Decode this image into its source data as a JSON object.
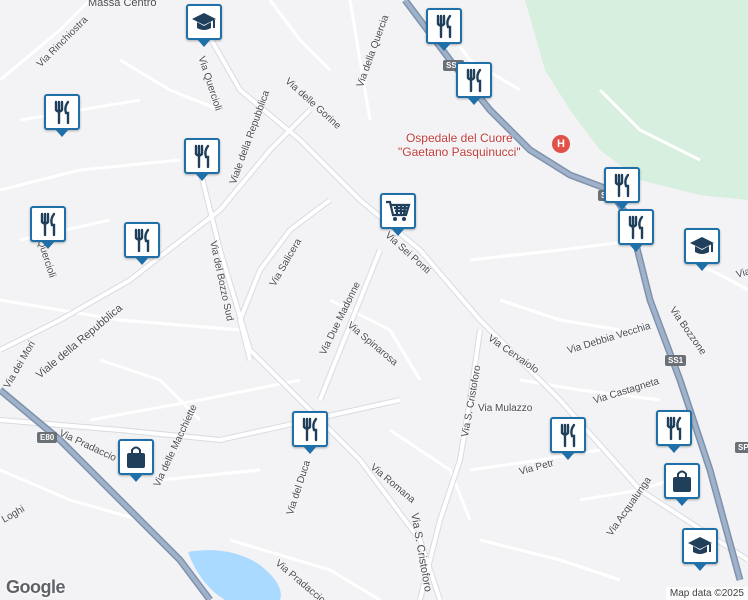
{
  "map": {
    "attribution_logo": "Google",
    "map_data": "Map data ©2025",
    "streets": [
      "Via Rinchiostra",
      "Massa Centro",
      "Via Quercioli",
      "Via delle Gorine",
      "Via della Quercia",
      "Viale della Repubblica",
      "Via Salicera",
      "Via del Bozzo Sud",
      "Via Sei Ponti",
      "Via Due Madonne",
      "Via Spinarosa",
      "Via Romana",
      "Viale della Repubblica",
      "Via dei Mori",
      "Via delle Macchiette",
      "Via Pradaccio",
      "Via del Duca",
      "Via S. Cristoforo",
      "Via Cervaiolo",
      "Via Debbia Vecchia",
      "Via Castagneta",
      "Via Mulazzo",
      "Via Bozzone",
      "Via Acqualunga",
      "Via Pradaccio",
      "Via Romana",
      "Via Quercioli",
      "Via S. Cristoforo",
      "Loghi",
      "Via Petr"
    ],
    "road_shields": [
      "SS1",
      "SS1",
      "SS1",
      "E80",
      "SP"
    ],
    "hospital": {
      "line1": "Ospedale del Cuore",
      "line2": "\"Gaetano Pasquinucci\"",
      "icon": "H"
    },
    "pois": [
      {
        "type": "restaurant-icon"
      },
      {
        "type": "restaurant-icon"
      },
      {
        "type": "restaurant-icon"
      },
      {
        "type": "restaurant-icon"
      },
      {
        "type": "restaurant-icon"
      },
      {
        "type": "restaurant-icon"
      },
      {
        "type": "restaurant-icon"
      },
      {
        "type": "restaurant-icon"
      },
      {
        "type": "restaurant-icon"
      },
      {
        "type": "restaurant-icon"
      },
      {
        "type": "restaurant-icon"
      },
      {
        "type": "school-icon"
      },
      {
        "type": "school-icon"
      },
      {
        "type": "school-icon"
      },
      {
        "type": "shopping-cart-icon"
      },
      {
        "type": "shopping-bag-icon"
      },
      {
        "type": "shopping-bag-icon"
      }
    ],
    "colors": {
      "land": "#f3f2f4",
      "park": "#d6efde",
      "water": "#aadaff",
      "highway": "#8ea6c2",
      "poi_border": "#1f6fa8",
      "hospital": "#e2504a"
    }
  }
}
